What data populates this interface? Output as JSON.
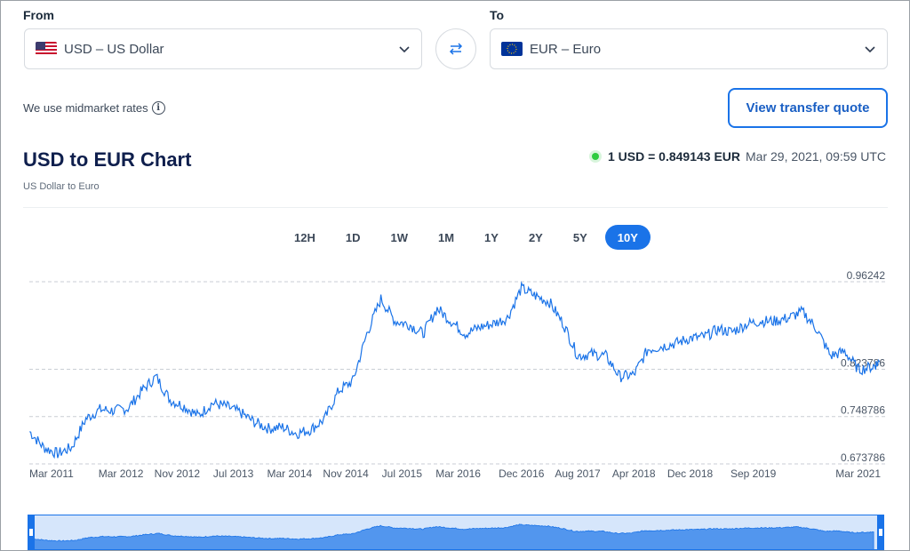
{
  "converter": {
    "from_label": "From",
    "to_label": "To",
    "from_value": "USD – US Dollar",
    "to_value": "EUR – Euro",
    "midmarket_text": "We use midmarket rates",
    "quote_button": "View transfer quote"
  },
  "header": {
    "title": "USD to EUR Chart",
    "subtitle": "US Dollar to Euro",
    "rate_text": "1 USD = 0.849143 EUR",
    "rate_time": "Mar 29, 2021, 09:59 UTC"
  },
  "ranges": [
    "12H",
    "1D",
    "1W",
    "1M",
    "1Y",
    "2Y",
    "5Y",
    "10Y"
  ],
  "active_range": "10Y",
  "colors": {
    "accent": "#1a73e8",
    "line": "#1a73e8",
    "area": "#1a73e8",
    "live_dot": "#2ecc40"
  },
  "chart_data": {
    "type": "line",
    "title": "USD to EUR Chart",
    "ylim": [
      0.673786,
      0.96242
    ],
    "yticks": [
      0.96242,
      0.823786,
      0.748786,
      0.673786
    ],
    "ytick_labels": [
      "0.96242",
      "0.823786",
      "0.748786",
      "0.673786"
    ],
    "grid": true,
    "xtick_labels": [
      "Mar 2011",
      "Mar 2012",
      "Nov 2012",
      "Jul 2013",
      "Mar 2014",
      "Nov 2014",
      "Jul 2015",
      "Mar 2016",
      "Dec 2016",
      "Aug 2017",
      "Apr 2018",
      "Dec 2018",
      "Sep 2019",
      "Mar 2021"
    ],
    "xtick_dates": [
      "2011-03",
      "2012-03",
      "2012-11",
      "2013-07",
      "2014-03",
      "2014-11",
      "2015-07",
      "2016-03",
      "2016-12",
      "2017-08",
      "2018-04",
      "2018-12",
      "2019-09",
      "2021-03"
    ],
    "series": [
      {
        "x": [
          "2011-02",
          "2011-04",
          "2011-06",
          "2011-08",
          "2011-10",
          "2011-12",
          "2012-02",
          "2012-04",
          "2012-06",
          "2012-08",
          "2012-10",
          "2012-12",
          "2013-02",
          "2013-04",
          "2013-06",
          "2013-08",
          "2013-10",
          "2013-12",
          "2014-02",
          "2014-04",
          "2014-06",
          "2014-08",
          "2014-10",
          "2014-12",
          "2015-02",
          "2015-04",
          "2015-06",
          "2015-08",
          "2015-10",
          "2015-12",
          "2016-02",
          "2016-04",
          "2016-06",
          "2016-08",
          "2016-10",
          "2016-12",
          "2017-02",
          "2017-04",
          "2017-06",
          "2017-08",
          "2017-10",
          "2017-12",
          "2018-02",
          "2018-04",
          "2018-06",
          "2018-08",
          "2018-10",
          "2018-12",
          "2019-02",
          "2019-04",
          "2019-06",
          "2019-08",
          "2019-10",
          "2019-12",
          "2020-02",
          "2020-04",
          "2020-06",
          "2020-08",
          "2020-10",
          "2020-12",
          "2021-02",
          "2021-03"
        ],
        "y": [
          0.725,
          0.7,
          0.69,
          0.7,
          0.745,
          0.76,
          0.758,
          0.762,
          0.79,
          0.812,
          0.775,
          0.765,
          0.75,
          0.77,
          0.765,
          0.755,
          0.74,
          0.73,
          0.732,
          0.722,
          0.728,
          0.745,
          0.79,
          0.805,
          0.88,
          0.935,
          0.9,
          0.895,
          0.88,
          0.92,
          0.9,
          0.88,
          0.89,
          0.896,
          0.905,
          0.952,
          0.94,
          0.93,
          0.895,
          0.845,
          0.848,
          0.845,
          0.812,
          0.815,
          0.855,
          0.86,
          0.865,
          0.873,
          0.875,
          0.887,
          0.883,
          0.895,
          0.9,
          0.9,
          0.905,
          0.915,
          0.888,
          0.845,
          0.852,
          0.823,
          0.828,
          0.836
        ]
      }
    ]
  }
}
